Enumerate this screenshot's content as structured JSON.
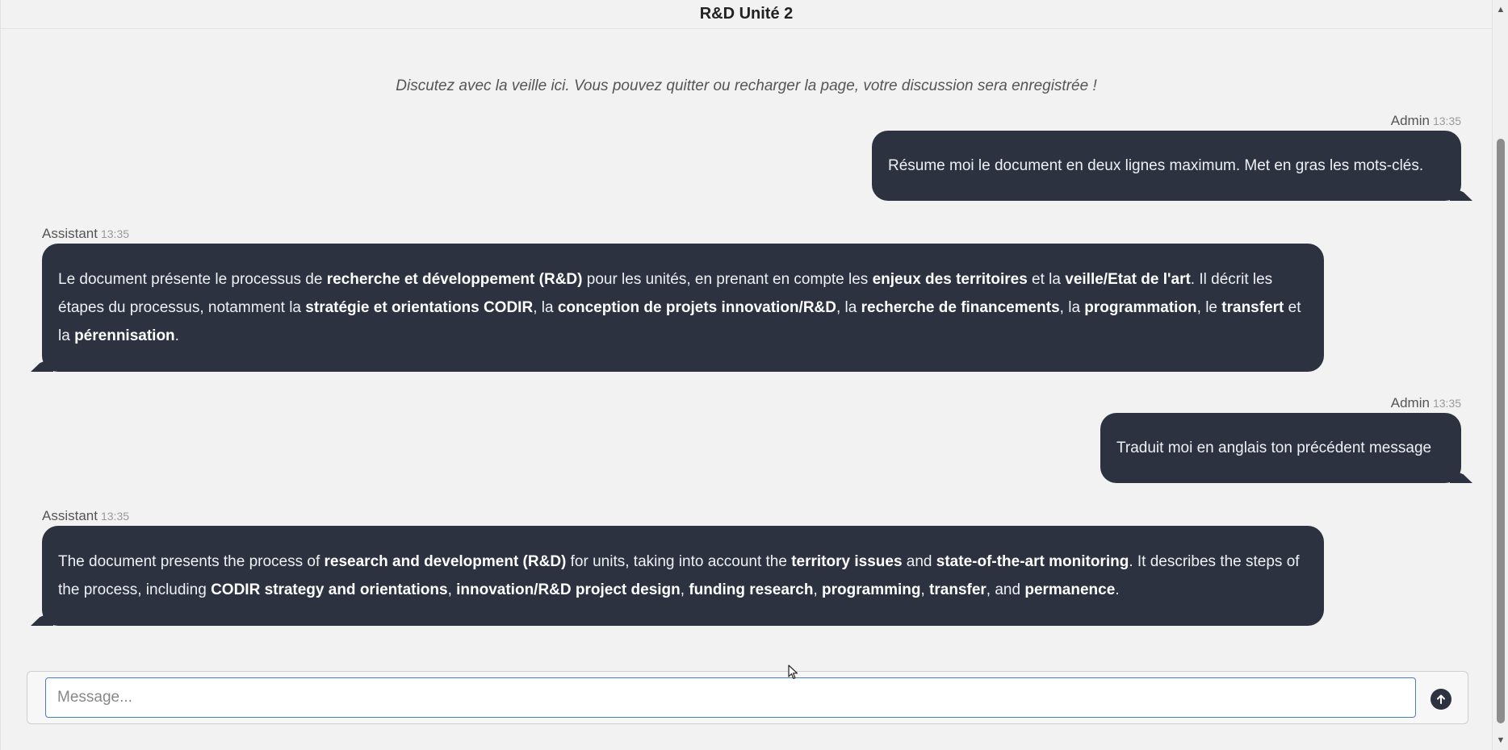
{
  "header": {
    "title": "R&D Unité 2"
  },
  "intro": "Discutez avec la veille ici. Vous pouvez quitter ou recharger la page, votre discussion sera enregistrée !",
  "messages": [
    {
      "author": "Admin",
      "time": "13:35",
      "segments": [
        {
          "t": "Résume moi le document en deux lignes maximum. Met en gras les mots-clés.",
          "b": false
        }
      ]
    },
    {
      "author": "Assistant",
      "time": "13:35",
      "segments": [
        {
          "t": "Le document présente le processus de ",
          "b": false
        },
        {
          "t": "recherche et développement (R&D)",
          "b": true
        },
        {
          "t": " pour les unités, en prenant en compte les ",
          "b": false
        },
        {
          "t": "enjeux des territoires",
          "b": true
        },
        {
          "t": " et la ",
          "b": false
        },
        {
          "t": "veille/Etat de l'art",
          "b": true
        },
        {
          "t": ". Il décrit les étapes du processus, notamment la ",
          "b": false
        },
        {
          "t": "stratégie et orientations CODIR",
          "b": true
        },
        {
          "t": ", la ",
          "b": false
        },
        {
          "t": "conception de projets innovation/R&D",
          "b": true
        },
        {
          "t": ", la ",
          "b": false
        },
        {
          "t": "recherche de financements",
          "b": true
        },
        {
          "t": ", la ",
          "b": false
        },
        {
          "t": "programmation",
          "b": true
        },
        {
          "t": ", le ",
          "b": false
        },
        {
          "t": "transfert",
          "b": true
        },
        {
          "t": " et la ",
          "b": false
        },
        {
          "t": "pérennisation",
          "b": true
        },
        {
          "t": ".",
          "b": false
        }
      ]
    },
    {
      "author": "Admin",
      "time": "13:35",
      "segments": [
        {
          "t": "Traduit moi en anglais ton précédent message",
          "b": false
        }
      ]
    },
    {
      "author": "Assistant",
      "time": "13:35",
      "segments": [
        {
          "t": "The document presents the process of ",
          "b": false
        },
        {
          "t": "research and development (R&D)",
          "b": true
        },
        {
          "t": " for units, taking into account the ",
          "b": false
        },
        {
          "t": "territory issues",
          "b": true
        },
        {
          "t": " and ",
          "b": false
        },
        {
          "t": "state-of-the-art monitoring",
          "b": true
        },
        {
          "t": ". It describes the steps of the process, including ",
          "b": false
        },
        {
          "t": "CODIR strategy and orientations",
          "b": true
        },
        {
          "t": ", ",
          "b": false
        },
        {
          "t": "innovation/R&D project design",
          "b": true
        },
        {
          "t": ", ",
          "b": false
        },
        {
          "t": "funding research",
          "b": true
        },
        {
          "t": ", ",
          "b": false
        },
        {
          "t": "programming",
          "b": true
        },
        {
          "t": ", ",
          "b": false
        },
        {
          "t": "transfer",
          "b": true
        },
        {
          "t": ", and ",
          "b": false
        },
        {
          "t": "permanence",
          "b": true
        },
        {
          "t": ".",
          "b": false
        }
      ]
    }
  ],
  "composer": {
    "placeholder": "Message..."
  },
  "icons": {
    "send": "arrow-up-circle-icon",
    "scroll_up": "triangle-up-icon",
    "scroll_down": "triangle-down-icon",
    "cursor": "mouse-pointer-icon"
  },
  "colors": {
    "bubble": "#2d3240",
    "input_border": "#4a7cc4",
    "background": "#f2f2f2"
  }
}
